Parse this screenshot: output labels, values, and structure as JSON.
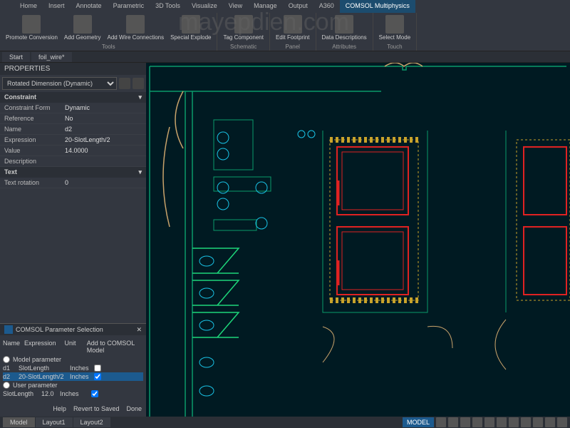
{
  "watermark": "mayepdien.com",
  "ribbon": {
    "tabs": [
      "Home",
      "Insert",
      "Annotate",
      "Parametric",
      "3D Tools",
      "Visualize",
      "View",
      "Manage",
      "Output",
      "A360",
      "COMSOL Multiphysics"
    ],
    "active_tab": "COMSOL Multiphysics",
    "groups": [
      {
        "label": "Tools",
        "buttons": [
          {
            "name": "promote-conversion",
            "label": "Promote Conversion"
          },
          {
            "name": "add-geometry",
            "label": "Add Geometry"
          },
          {
            "name": "add-wire-connections",
            "label": "Add Wire Connections"
          },
          {
            "name": "special-explode",
            "label": "Special Explode"
          }
        ]
      },
      {
        "label": "Schematic",
        "buttons": [
          {
            "name": "tag-component",
            "label": "Tag Component"
          }
        ]
      },
      {
        "label": "Panel",
        "buttons": [
          {
            "name": "edit-footprint",
            "label": "Edit Footprint"
          }
        ]
      },
      {
        "label": "Attributes",
        "buttons": [
          {
            "name": "data-descriptions",
            "label": "Data Descriptions"
          }
        ]
      },
      {
        "label": "Touch",
        "buttons": [
          {
            "name": "select-mode",
            "label": "Select Mode"
          }
        ]
      }
    ]
  },
  "docktabs": [
    "Start",
    "foil_wire*"
  ],
  "properties": {
    "title": "PROPERTIES",
    "selector": "Rotated Dimension (Dynamic)",
    "sections": {
      "constraint": {
        "label": "Constraint",
        "rows": [
          {
            "k": "Constraint Form",
            "v": "Dynamic"
          },
          {
            "k": "Reference",
            "v": "No"
          },
          {
            "k": "Name",
            "v": "d2"
          },
          {
            "k": "Expression",
            "v": "20-SlotLength/2"
          },
          {
            "k": "Value",
            "v": "14.0000"
          },
          {
            "k": "Description",
            "v": ""
          }
        ]
      },
      "text": {
        "label": "Text",
        "rows": [
          {
            "k": "Text rotation",
            "v": "0"
          }
        ]
      }
    }
  },
  "comsol": {
    "title": "COMSOL Parameter Selection",
    "headers": [
      "Name",
      "Expression",
      "Unit",
      "Add to COMSOL Model"
    ],
    "model_param_label": "Model parameter",
    "user_param_label": "User parameter",
    "rows": [
      {
        "name": "d1",
        "expr": "SlotLength",
        "unit": "Inches",
        "add": false
      },
      {
        "name": "d2",
        "expr": "20-SlotLength/2",
        "unit": "Inches",
        "add": true
      }
    ],
    "user_row": {
      "name": "SlotLength",
      "value": "12.0",
      "unit": "Inches",
      "add": true
    },
    "footer": [
      "Help",
      "Revert to Saved",
      "Done"
    ]
  },
  "status": {
    "left_tabs": [
      "Model",
      "Layout1",
      "Layout2"
    ],
    "active_tab": "Model",
    "model_btn": "MODEL"
  }
}
